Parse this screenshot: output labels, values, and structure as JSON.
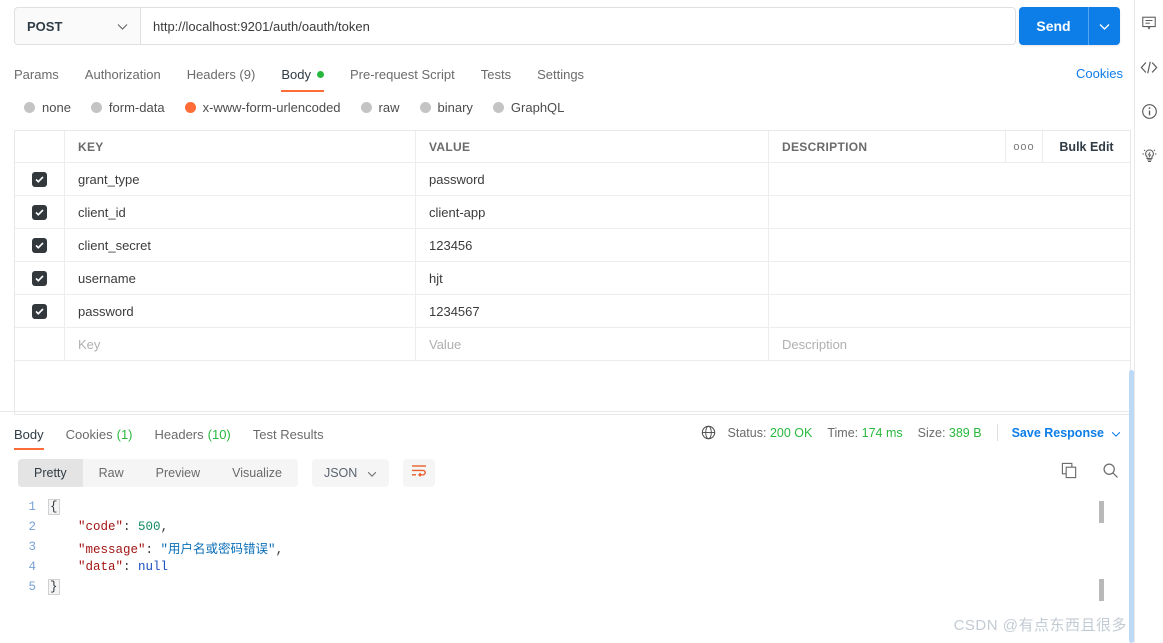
{
  "request": {
    "method": "POST",
    "url": "http://localhost:9201/auth/oauth/token",
    "send_label": "Send",
    "tabs": [
      {
        "label": "Params",
        "active": false,
        "dot": false
      },
      {
        "label": "Authorization",
        "active": false,
        "dot": false
      },
      {
        "label": "Headers (9)",
        "active": false,
        "dot": false
      },
      {
        "label": "Body",
        "active": true,
        "dot": true
      },
      {
        "label": "Pre-request Script",
        "active": false,
        "dot": false
      },
      {
        "label": "Tests",
        "active": false,
        "dot": false
      },
      {
        "label": "Settings",
        "active": false,
        "dot": false
      }
    ],
    "cookies_link": "Cookies",
    "body_types": [
      {
        "label": "none",
        "selected": false
      },
      {
        "label": "form-data",
        "selected": false
      },
      {
        "label": "x-www-form-urlencoded",
        "selected": true
      },
      {
        "label": "raw",
        "selected": false
      },
      {
        "label": "binary",
        "selected": false
      },
      {
        "label": "GraphQL",
        "selected": false
      }
    ]
  },
  "params_table": {
    "headers": {
      "key": "KEY",
      "value": "VALUE",
      "description": "DESCRIPTION"
    },
    "more_label": "ooo",
    "bulk_edit_label": "Bulk Edit",
    "rows": [
      {
        "checked": true,
        "key": "grant_type",
        "value": "password",
        "description": ""
      },
      {
        "checked": true,
        "key": "client_id",
        "value": "client-app",
        "description": ""
      },
      {
        "checked": true,
        "key": "client_secret",
        "value": "123456",
        "description": ""
      },
      {
        "checked": true,
        "key": "username",
        "value": "hjt",
        "description": ""
      },
      {
        "checked": true,
        "key": "password",
        "value": "1234567",
        "description": ""
      }
    ],
    "placeholder_row": {
      "key": "Key",
      "value": "Value",
      "description": "Description"
    }
  },
  "response": {
    "tabs": [
      {
        "label": "Body",
        "count": "",
        "active": true
      },
      {
        "label": "Cookies",
        "count": "(1)",
        "active": false
      },
      {
        "label": "Headers",
        "count": "(10)",
        "active": false
      },
      {
        "label": "Test Results",
        "count": "",
        "active": false
      }
    ],
    "status_label": "Status:",
    "status_value": "200 OK",
    "time_label": "Time:",
    "time_value": "174 ms",
    "size_label": "Size:",
    "size_value": "389 B",
    "save_response": "Save Response",
    "view_modes": [
      {
        "label": "Pretty",
        "active": true
      },
      {
        "label": "Raw",
        "active": false
      },
      {
        "label": "Preview",
        "active": false
      },
      {
        "label": "Visualize",
        "active": false
      }
    ],
    "format": "JSON",
    "body_lines": [
      {
        "n": "1",
        "segments": [
          {
            "t": "{",
            "c": "fold"
          }
        ]
      },
      {
        "n": "2",
        "segments": [
          {
            "t": "    ",
            "c": "pun"
          },
          {
            "t": "\"code\"",
            "c": "k"
          },
          {
            "t": ": ",
            "c": "pun"
          },
          {
            "t": "500",
            "c": "num"
          },
          {
            "t": ",",
            "c": "pun"
          }
        ]
      },
      {
        "n": "3",
        "segments": [
          {
            "t": "    ",
            "c": "pun"
          },
          {
            "t": "\"message\"",
            "c": "k"
          },
          {
            "t": ": ",
            "c": "pun"
          },
          {
            "t": "\"用户名或密码错误\"",
            "c": "str"
          },
          {
            "t": ",",
            "c": "pun"
          }
        ]
      },
      {
        "n": "4",
        "segments": [
          {
            "t": "    ",
            "c": "pun"
          },
          {
            "t": "\"data\"",
            "c": "k"
          },
          {
            "t": ": ",
            "c": "pun"
          },
          {
            "t": "null",
            "c": "nul"
          }
        ]
      },
      {
        "n": "5",
        "segments": [
          {
            "t": "}",
            "c": "fold"
          }
        ]
      }
    ]
  },
  "watermark": "CSDN @有点东西且很多"
}
